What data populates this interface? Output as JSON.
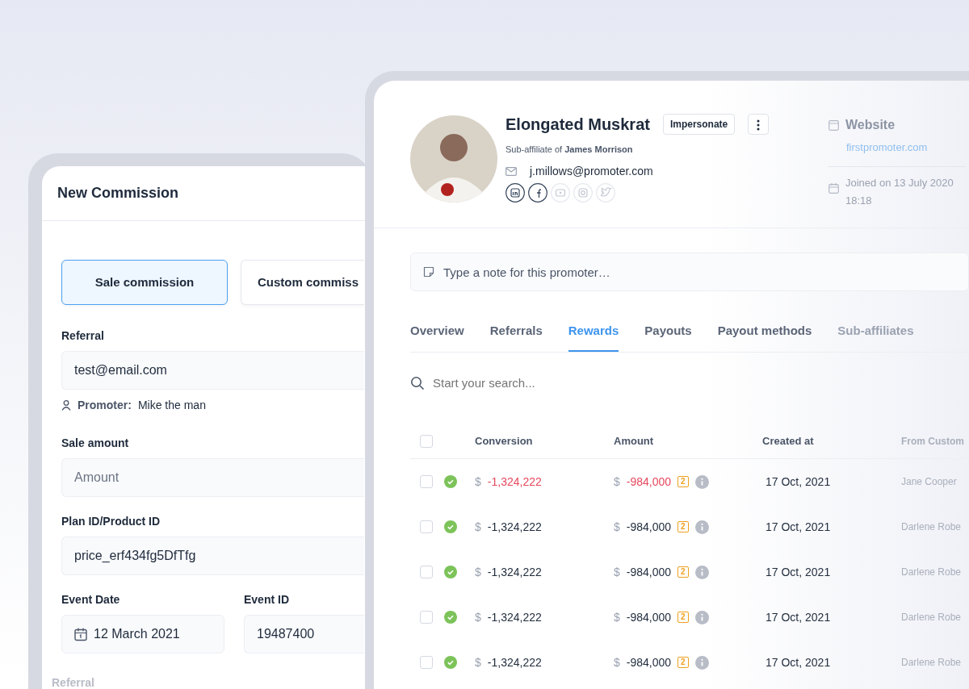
{
  "commission_form": {
    "title": "New Commission",
    "types": [
      {
        "label": "Sale commission",
        "selected": true
      },
      {
        "label": "Custom commiss",
        "selected": false
      }
    ],
    "referral": {
      "label": "Referral",
      "value": "test@email.com",
      "promoter_label": "Promoter:",
      "promoter": "Mike the man"
    },
    "sale_amount": {
      "label": "Sale amount",
      "placeholder": "Amount"
    },
    "plan": {
      "label": "Plan ID/Product ID",
      "value": "price_erf434fg5DfTfg"
    },
    "event_date": {
      "label": "Event Date",
      "value": "12 March 2021"
    },
    "event_id": {
      "label": "Event ID",
      "value": "19487400"
    },
    "next_label": "Referral"
  },
  "promoter": {
    "name": "Elongated Muskrat",
    "impersonate": "Impersonate",
    "subtitle": "Sub-affiliate of **James Morrison**",
    "email": "j.millows@promoter.com",
    "socials": [
      {
        "kind": "linkedin",
        "connected": true
      },
      {
        "kind": "facebook",
        "connected": true
      },
      {
        "kind": "youtube",
        "connected": false
      },
      {
        "kind": "instagram",
        "connected": false
      },
      {
        "kind": "twitter",
        "connected": false
      }
    ],
    "website_label": "Website",
    "website": "firstpromoter.com",
    "joined_date": "Joined on 13 July 2020",
    "joined_time": "18:18"
  },
  "note": {
    "placeholder": "Type a note for this promoter…"
  },
  "tabs": [
    {
      "label": "Overview",
      "selected": false
    },
    {
      "label": "Referrals",
      "selected": false
    },
    {
      "label": "Rewards",
      "selected": true
    },
    {
      "label": "Payouts",
      "selected": false
    },
    {
      "label": "Payout methods",
      "selected": false
    },
    {
      "label": "Sub-affiliates",
      "selected": false
    }
  ],
  "search": {
    "placeholder": "Start your search..."
  },
  "table": {
    "all_selected": false,
    "columns": [
      "Conversion",
      "Amount",
      "Created at",
      "From Custom"
    ],
    "rows": [
      {
        "selected": false,
        "approved": true,
        "negative": true,
        "currency": "$",
        "conversion": "-1,324,222",
        "amount_currency": "$",
        "amount": "-984,000",
        "count": "2",
        "created": "17 Oct, 2021",
        "customer": "Jane Cooper"
      },
      {
        "selected": false,
        "approved": true,
        "negative": false,
        "currency": "$",
        "conversion": "-1,324,222",
        "amount_currency": "$",
        "amount": "-984,000",
        "count": "2",
        "created": "17 Oct, 2021",
        "customer": "Darlene Robe"
      },
      {
        "selected": false,
        "approved": true,
        "negative": false,
        "currency": "$",
        "conversion": "-1,324,222",
        "amount_currency": "$",
        "amount": "-984,000",
        "count": "2",
        "created": "17 Oct, 2021",
        "customer": "Darlene Robe"
      },
      {
        "selected": false,
        "approved": true,
        "negative": false,
        "currency": "$",
        "conversion": "-1,324,222",
        "amount_currency": "$",
        "amount": "-984,000",
        "count": "2",
        "created": "17 Oct, 2021",
        "customer": "Darlene Robe"
      },
      {
        "selected": false,
        "approved": true,
        "negative": false,
        "currency": "$",
        "conversion": "-1,324,222",
        "amount_currency": "$",
        "amount": "-984,000",
        "count": "2",
        "created": "17 Oct, 2021",
        "customer": "Darlene Robe"
      }
    ]
  }
}
